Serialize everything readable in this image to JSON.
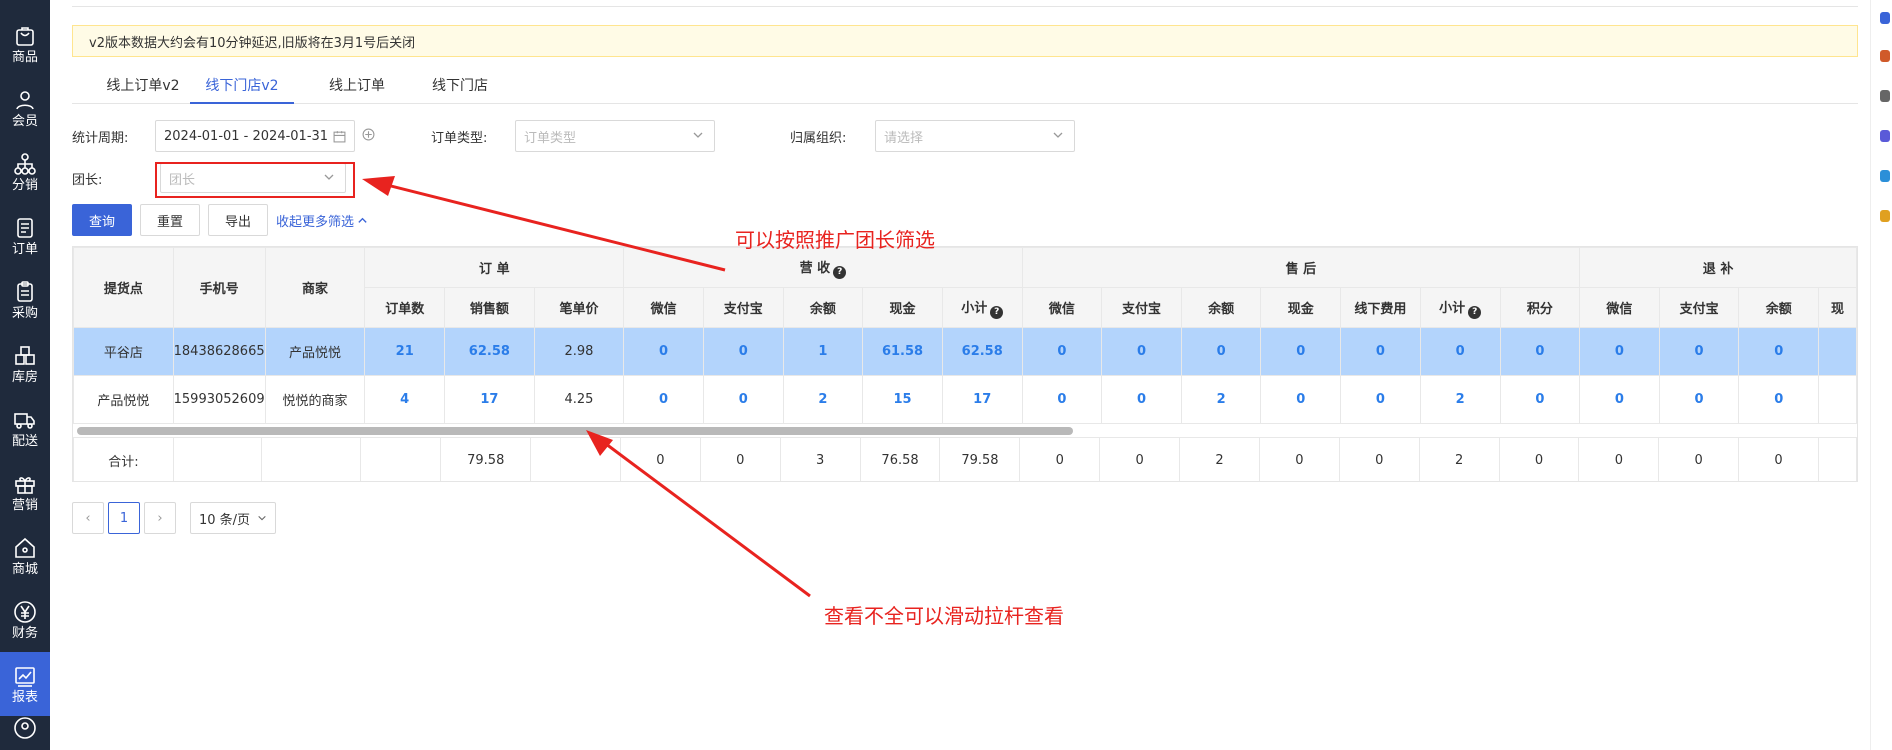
{
  "sidebar": {
    "items": [
      {
        "label": "商品",
        "icon": "shopping-bag-icon",
        "active": false
      },
      {
        "label": "会员",
        "icon": "user-icon",
        "active": false
      },
      {
        "label": "分销",
        "icon": "org-tree-icon",
        "active": false
      },
      {
        "label": "订单",
        "icon": "document-icon",
        "active": false
      },
      {
        "label": "采购",
        "icon": "clipboard-icon",
        "active": false
      },
      {
        "label": "库房",
        "icon": "warehouse-icon",
        "active": false
      },
      {
        "label": "配送",
        "icon": "truck-icon",
        "active": false
      },
      {
        "label": "营销",
        "icon": "gift-icon",
        "active": false
      },
      {
        "label": "商城",
        "icon": "home-icon",
        "active": false
      },
      {
        "label": "财务",
        "icon": "yen-icon",
        "active": false
      },
      {
        "label": "报表",
        "icon": "chart-icon",
        "active": true
      }
    ],
    "active_color": "#3a64d8",
    "bg_color": "#1f2a3c"
  },
  "notice": {
    "text": "v2版本数据大约会有10分钟延迟,旧版将在3月1号后关闭"
  },
  "tabs": [
    {
      "label": "线上订单v2",
      "active": false
    },
    {
      "label": "线下门店v2",
      "active": true
    },
    {
      "label": "线上订单",
      "active": false
    },
    {
      "label": "线下门店",
      "active": false
    }
  ],
  "filters": {
    "period_label": "统计周期:",
    "period_value": "2024-01-01 - 2024-01-31",
    "order_type_label": "订单类型:",
    "order_type_placeholder": "订单类型",
    "org_label": "归属组织:",
    "org_placeholder": "请选择",
    "leader_label": "团长:",
    "leader_placeholder": "团长"
  },
  "actions": {
    "query": "查询",
    "reset": "重置",
    "export": "导出",
    "collapse": "收起更多筛选"
  },
  "table": {
    "fixed_headers": [
      "提货点",
      "手机号",
      "商家"
    ],
    "groups": [
      "订 单",
      "营 收",
      "售 后",
      "退 补"
    ],
    "sub_headers": [
      "订单数",
      "销售额",
      "笔单价",
      "微信",
      "支付宝",
      "余额",
      "现金",
      "小计",
      "微信",
      "支付宝",
      "余额",
      "现金",
      "线下费用",
      "小计",
      "积分",
      "微信",
      "支付宝",
      "余额",
      "现"
    ],
    "rows": [
      {
        "store": "平谷店",
        "phone": "18438628665",
        "merchant": "产品悦悦",
        "values": [
          "21",
          "62.58",
          "2.98",
          "0",
          "0",
          "1",
          "61.58",
          "62.58",
          "0",
          "0",
          "0",
          "0",
          "0",
          "0",
          "0",
          "0",
          "0",
          "0",
          ""
        ]
      },
      {
        "store": "产品悦悦",
        "phone": "15993052609",
        "merchant": "悦悦的商家",
        "values": [
          "4",
          "17",
          "4.25",
          "0",
          "0",
          "2",
          "15",
          "17",
          "0",
          "0",
          "2",
          "0",
          "0",
          "2",
          "0",
          "0",
          "0",
          "0",
          ""
        ]
      }
    ],
    "total": {
      "label": "合计:",
      "values": [
        "",
        "79.58",
        "",
        "0",
        "0",
        "3",
        "76.58",
        "79.58",
        "0",
        "0",
        "2",
        "0",
        "0",
        "2",
        "0",
        "0",
        "0",
        "0",
        ""
      ]
    }
  },
  "pagination": {
    "prev": "‹",
    "current": "1",
    "next": "›",
    "page_size": "10 条/页"
  },
  "annotations": {
    "leader_filter_note": "可以按照推广团长筛选",
    "scroll_note": "查看不全可以滑动拉杆查看",
    "color": "#e8231f"
  }
}
